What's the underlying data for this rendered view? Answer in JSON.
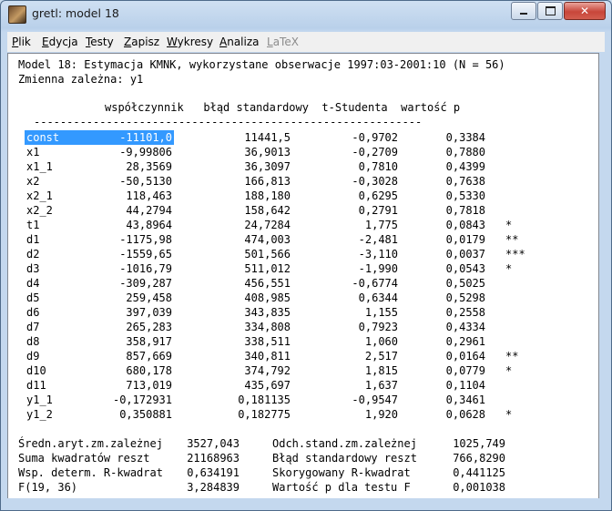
{
  "window": {
    "title": "gretl: model 18"
  },
  "menu": [
    {
      "label": "Plik",
      "underline": "P",
      "rest": "lik",
      "enabled": true
    },
    {
      "label": "Edycja",
      "underline": "E",
      "rest": "dycja",
      "enabled": true
    },
    {
      "label": "Testy",
      "underline": "T",
      "rest": "esty",
      "enabled": true
    },
    {
      "label": "Zapisz",
      "underline": "Z",
      "rest": "apisz",
      "enabled": true
    },
    {
      "label": "Wykresy",
      "underline": "W",
      "rest": "ykresy",
      "enabled": true
    },
    {
      "label": "Analiza",
      "underline": "A",
      "rest": "naliza",
      "enabled": true
    },
    {
      "label": "LaTeX",
      "underline": "L",
      "rest": "aTeX",
      "enabled": false
    }
  ],
  "output": {
    "header_line1": "Model 18: Estymacja KMNK, wykorzystane obserwacje 1997:03-2001:10 (N = 56)",
    "header_line2": "Zmienna zależna: y1",
    "col_headers": "współczynnik   błąd standardowy  t-Studenta  wartość p",
    "rule": "-----------------------------------------------------------",
    "rows": [
      [
        "const",
        "-11101,0",
        "11441,5",
        "-0,9702",
        "0,3384",
        ""
      ],
      [
        "x1",
        "-9,99806",
        "36,9013",
        "-0,2709",
        "0,7880",
        ""
      ],
      [
        "x1_1",
        "28,3569",
        "36,3097",
        "0,7810",
        "0,4399",
        ""
      ],
      [
        "x2",
        "-50,5130",
        "166,813",
        "-0,3028",
        "0,7638",
        ""
      ],
      [
        "x2_1",
        "118,463",
        "188,180",
        "0,6295",
        "0,5330",
        ""
      ],
      [
        "x2_2",
        "44,2794",
        "158,642",
        "0,2791",
        "0,7818",
        ""
      ],
      [
        "t1",
        "43,8964",
        "24,7284",
        "1,775",
        "0,0843",
        "*"
      ],
      [
        "d1",
        "-1175,98",
        "474,003",
        "-2,481",
        "0,0179",
        "**"
      ],
      [
        "d2",
        "-1559,65",
        "501,566",
        "-3,110",
        "0,0037",
        "***"
      ],
      [
        "d3",
        "-1016,79",
        "511,012",
        "-1,990",
        "0,0543",
        "*"
      ],
      [
        "d4",
        "-309,287",
        "456,551",
        "-0,6774",
        "0,5025",
        ""
      ],
      [
        "d5",
        "259,458",
        "408,985",
        "0,6344",
        "0,5298",
        ""
      ],
      [
        "d6",
        "397,039",
        "343,835",
        "1,155",
        "0,2558",
        ""
      ],
      [
        "d7",
        "265,283",
        "334,808",
        "0,7923",
        "0,4334",
        ""
      ],
      [
        "d8",
        "358,917",
        "338,511",
        "1,060",
        "0,2961",
        ""
      ],
      [
        "d9",
        "857,669",
        "340,811",
        "2,517",
        "0,0164",
        "**"
      ],
      [
        "d10",
        "680,178",
        "374,792",
        "1,815",
        "0,0779",
        "*"
      ],
      [
        "d11",
        "713,019",
        "435,697",
        "1,637",
        "0,1104",
        ""
      ],
      [
        "y1_1",
        "-0,172931",
        "0,181135",
        "-0,9547",
        "0,3461",
        ""
      ],
      [
        "y1_2",
        "0,350881",
        "0,182775",
        "1,920",
        "0,0628",
        "*"
      ]
    ],
    "stats": [
      [
        "Średn.aryt.zm.zależnej",
        "3527,043",
        "Odch.stand.zm.zależnej",
        "1025,749"
      ],
      [
        "Suma kwadratów reszt",
        "21168963",
        "Błąd standardowy reszt",
        "766,8290"
      ],
      [
        "Wsp. determ. R-kwadrat",
        "0,634191",
        "Skorygowany R-kwadrat",
        "0,441125"
      ],
      [
        "F(19, 36)",
        "3,284839",
        "Wartość p dla testu F",
        "0,001038"
      ]
    ]
  }
}
